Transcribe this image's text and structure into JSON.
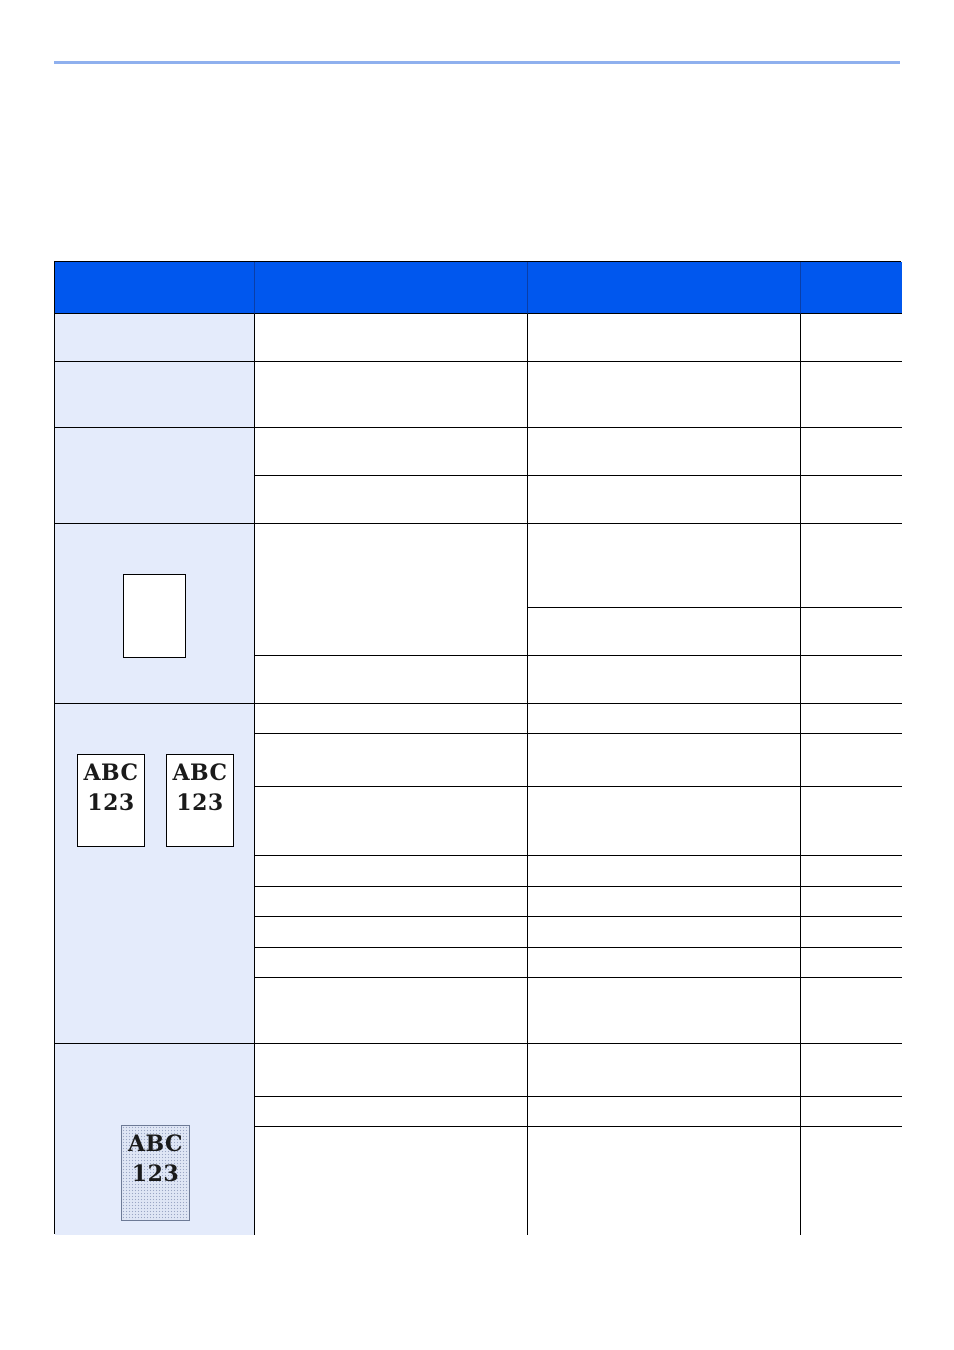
{
  "samples": {
    "left_page": [
      "ABC",
      "123"
    ],
    "right_page": [
      "ABC",
      "123"
    ],
    "shaded_page": [
      "ABC",
      "123"
    ]
  },
  "colors": {
    "header": "#0057ee",
    "shaded_cell": "#e4ebfb",
    "top_rule": "#8fb0ee"
  }
}
